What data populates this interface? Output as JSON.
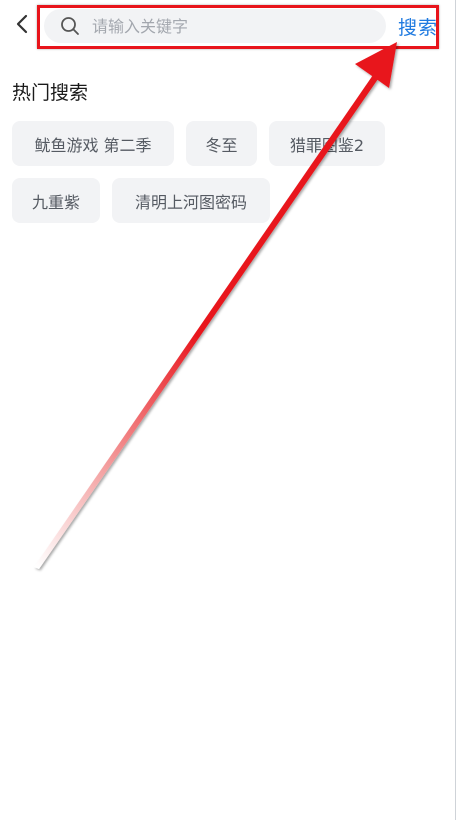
{
  "header": {
    "back_icon": "chevron-left-icon",
    "search": {
      "placeholder": "请输入关键字",
      "value": "",
      "icon": "search-icon"
    },
    "search_button_label": "搜索"
  },
  "hot_search": {
    "title": "热门搜索",
    "rows": [
      [
        "鱿鱼游戏 第二季",
        "冬至",
        "猎罪图鉴2"
      ],
      [
        "九重紫",
        "清明上河图密码"
      ]
    ]
  },
  "annotation": {
    "color": "#e8141b",
    "type": "arrow-and-box"
  },
  "colors": {
    "accent": "#1f7ae0",
    "tag_bg": "#f2f3f5",
    "annotation": "#e8141b"
  }
}
